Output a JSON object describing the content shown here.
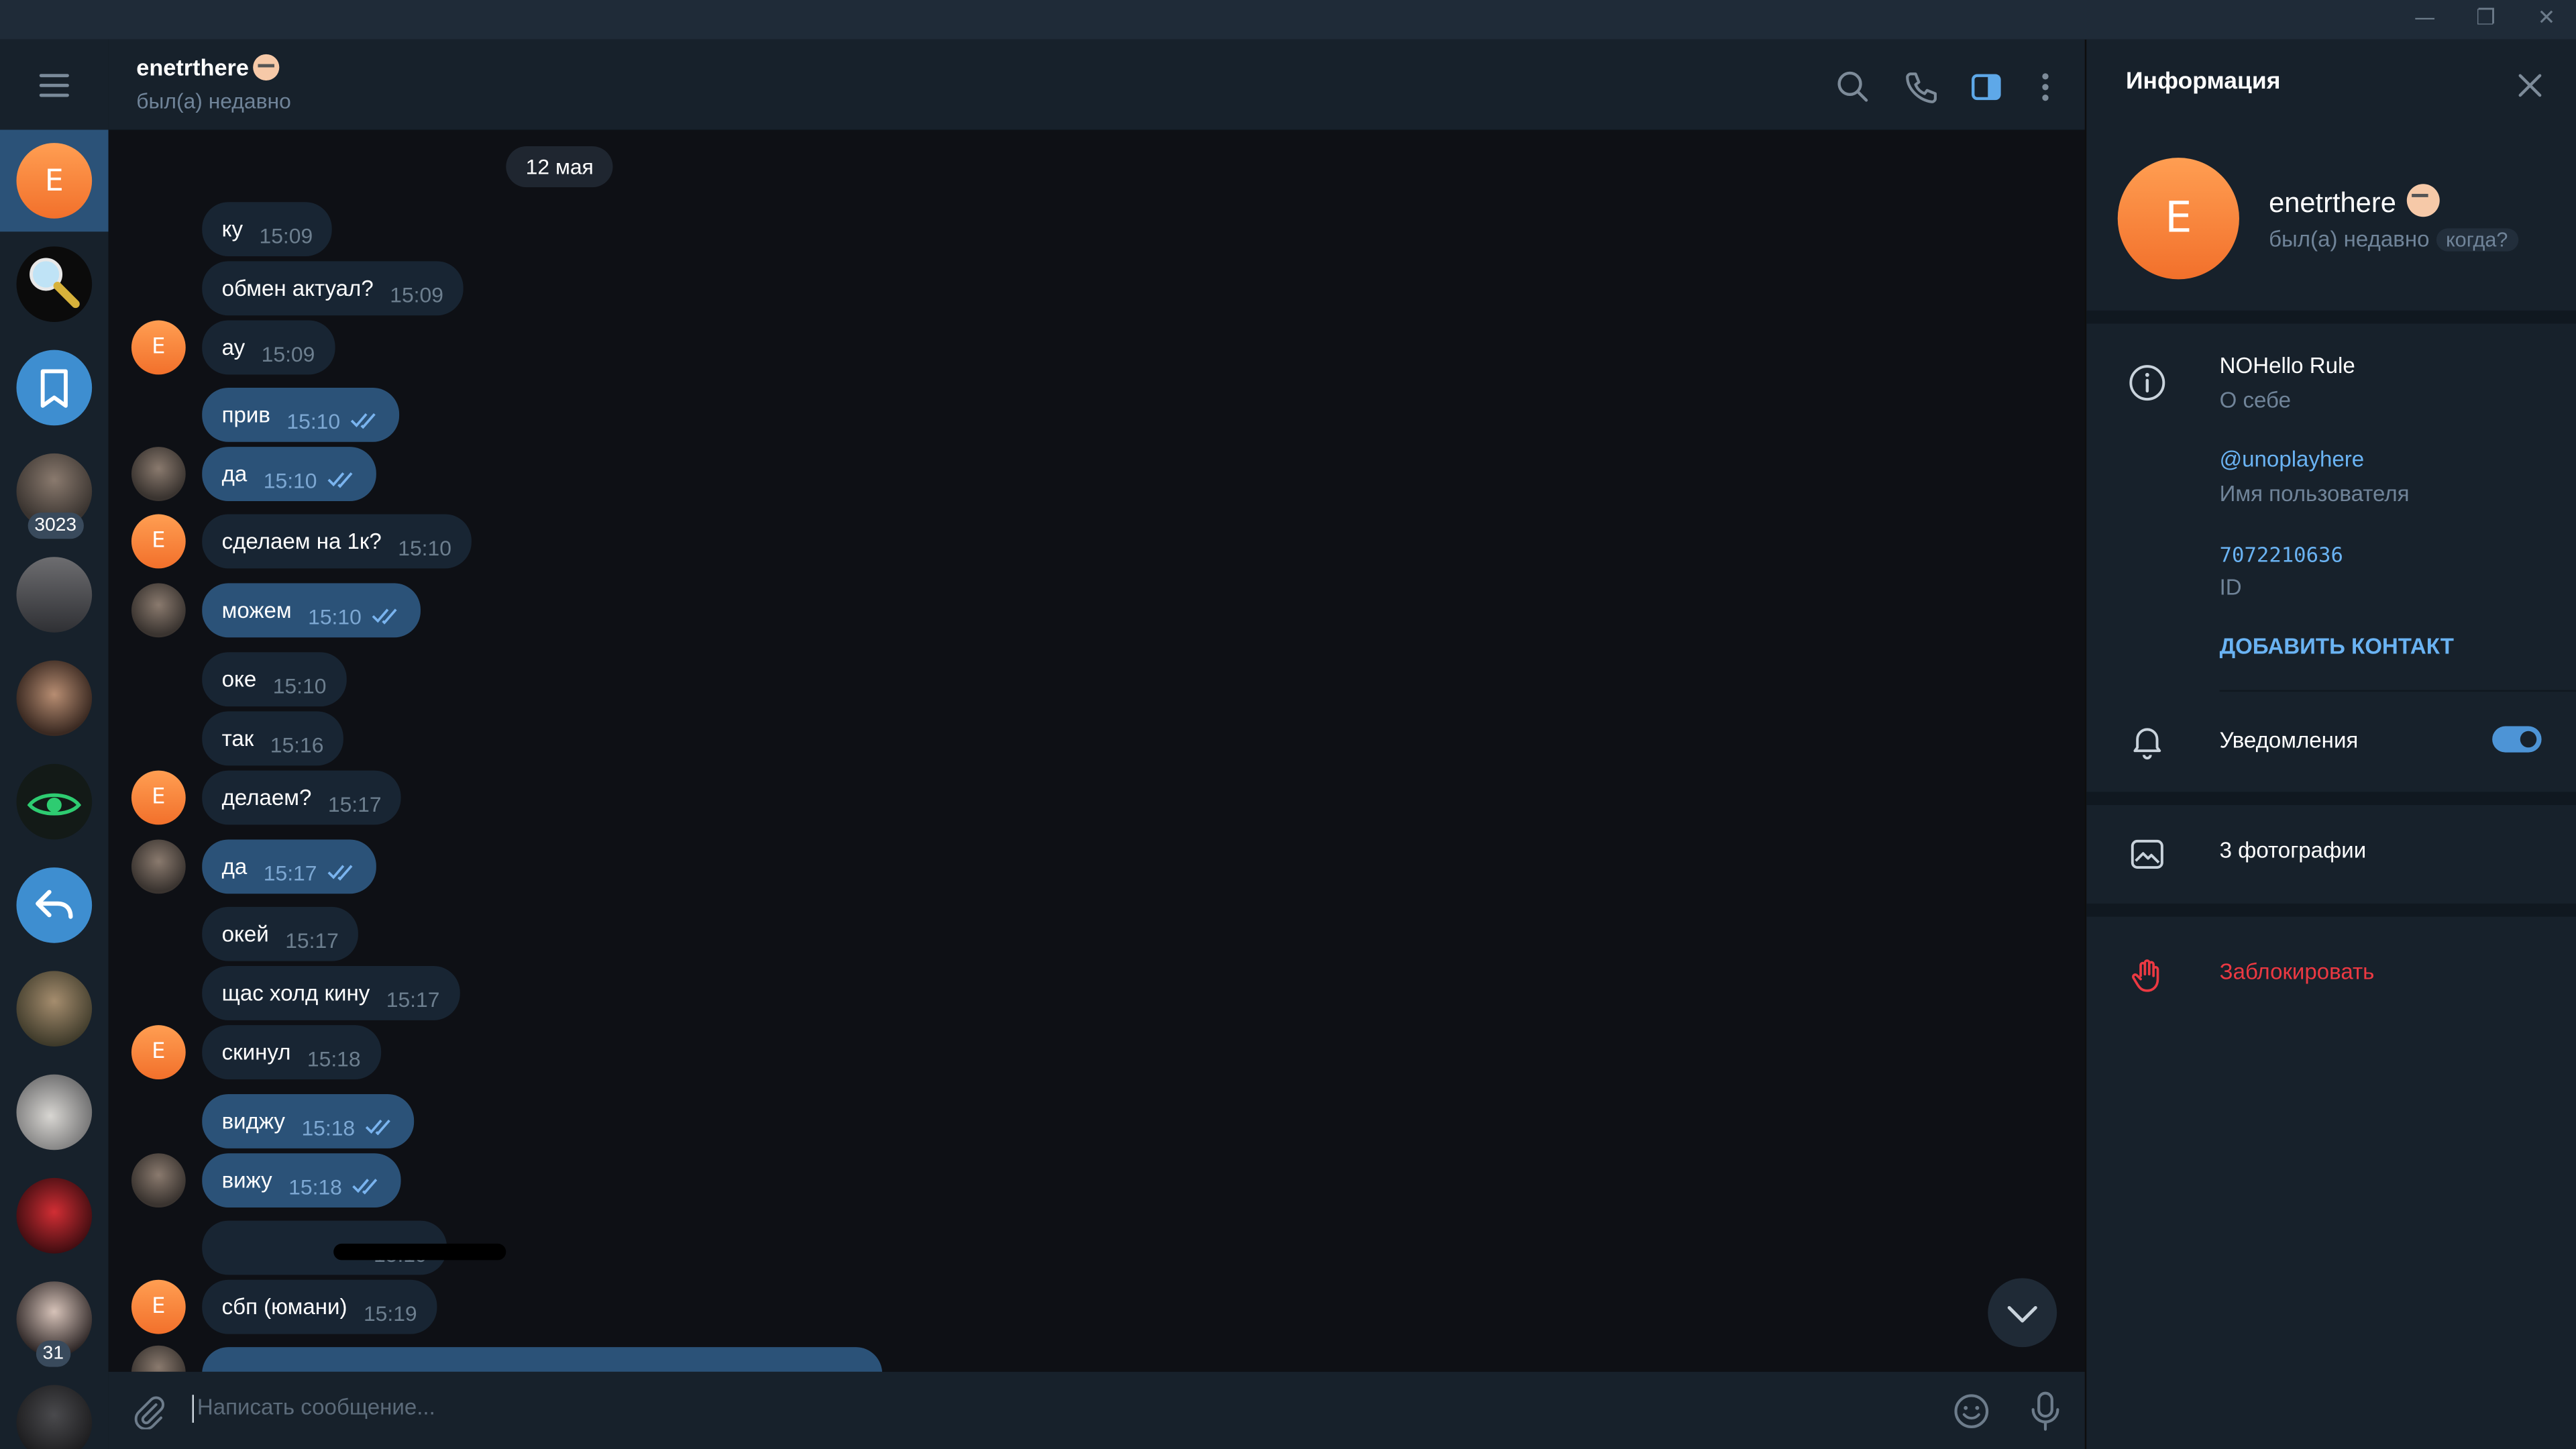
{
  "window": {
    "minimize_glyph": "—",
    "restore_glyph": "❐",
    "close_glyph": "✕"
  },
  "sidebar": {
    "items": [
      {
        "name": "chat-e",
        "letter": "E",
        "active": true
      },
      {
        "name": "search-bot",
        "icon": "magnifier-icon"
      },
      {
        "name": "saved-messages",
        "icon": "bookmark-icon"
      },
      {
        "name": "chat-photo-1",
        "badge": "3023"
      },
      {
        "name": "chat-photo-2"
      },
      {
        "name": "chat-photo-3"
      },
      {
        "name": "chat-eye",
        "icon": "eye-icon"
      },
      {
        "name": "chat-reply",
        "icon": "reply-icon"
      },
      {
        "name": "chat-photo-4"
      },
      {
        "name": "chat-photo-5"
      },
      {
        "name": "chat-photo-6"
      },
      {
        "name": "chat-photo-7",
        "badge": "31"
      },
      {
        "name": "chat-photo-8"
      }
    ]
  },
  "header": {
    "title": "enetrthere",
    "status": "был(а) недавно"
  },
  "chat": {
    "date": "12 мая",
    "messages": [
      {
        "text": "ку",
        "time": "15:09",
        "out": false
      },
      {
        "text": "обмен актуал?",
        "time": "15:09",
        "out": false
      },
      {
        "text": "ау",
        "time": "15:09",
        "out": false
      },
      {
        "text": "прив",
        "time": "15:10",
        "out": true
      },
      {
        "text": "да",
        "time": "15:10",
        "out": true
      },
      {
        "text": "сделаем на 1к?",
        "time": "15:10",
        "out": false
      },
      {
        "text": "можем",
        "time": "15:10",
        "out": true
      },
      {
        "text": "оке",
        "time": "15:10",
        "out": false
      },
      {
        "text": "так",
        "time": "15:16",
        "out": false
      },
      {
        "text": "делаем?",
        "time": "15:17",
        "out": false
      },
      {
        "text": "да",
        "time": "15:17",
        "out": true
      },
      {
        "text": "окей",
        "time": "15:17",
        "out": false
      },
      {
        "text": "щас холд кину",
        "time": "15:17",
        "out": false
      },
      {
        "text": "скинул",
        "time": "15:18",
        "out": false
      },
      {
        "text": "виджу",
        "time": "15:18",
        "out": true
      },
      {
        "text": "вижу",
        "time": "15:18",
        "out": true
      },
      {
        "text": "",
        "time": "15:19",
        "out": false
      },
      {
        "text": "сбп (юмани)",
        "time": "15:19",
        "out": false
      }
    ]
  },
  "composer": {
    "placeholder": "Написать сообщение..."
  },
  "info": {
    "title": "Информация",
    "avatar_letter": "E",
    "name": "enetrthere",
    "status": "был(а) недавно",
    "when_badge": "когда?",
    "bio": "NOHello Rule",
    "bio_label": "О себе",
    "username": "@unoplayhere",
    "username_label": "Имя пользователя",
    "id": "7072210636",
    "id_label": "ID",
    "add_contact": "ДОБАВИТЬ КОНТАКТ",
    "notifications_label": "Уведомления",
    "notifications_on": true,
    "photos": "3 фотографии",
    "block": "Заблокировать"
  },
  "colors": {
    "accent": "#2b5278",
    "link": "#6ab3f3",
    "danger": "#ec3942",
    "panel": "#17212b",
    "orange_avatar": "#f2702b"
  }
}
